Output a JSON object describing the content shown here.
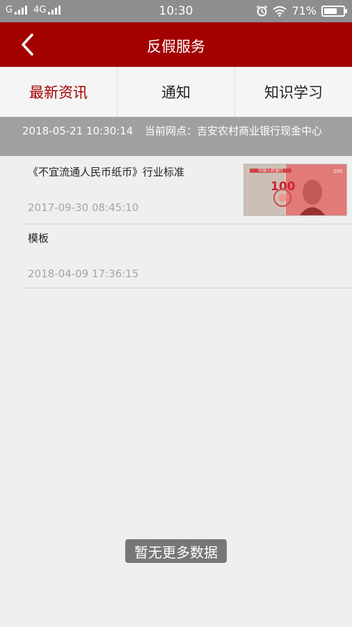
{
  "status_bar": {
    "carrier1": "G",
    "carrier2": "4G",
    "time": "10:30",
    "battery": "71%",
    "battery_level": 0.71
  },
  "header": {
    "title": "反假服务",
    "back_icon": "chevron-left-icon"
  },
  "tabs": [
    {
      "label": "最新资讯",
      "active": true
    },
    {
      "label": "通知",
      "active": false
    },
    {
      "label": "知识学习",
      "active": false
    }
  ],
  "info_bar": {
    "timestamp": "2018-05-21 10:30:14",
    "location_label": "当前网点：",
    "location_value": "吉安农村商业银行现金中心"
  },
  "news": [
    {
      "title": "《不宜流通人民币纸币》行业标准",
      "date": "2017-09-30 08:45:10",
      "has_thumbnail": true
    },
    {
      "title": "模板",
      "date": "2018-04-09 17:36:15",
      "has_thumbnail": false
    }
  ],
  "thumbnail": {
    "denomination": "100",
    "bank_text": "中国人民银行"
  },
  "toast": "暂无更多数据",
  "colors": {
    "brand_red": "#a30000",
    "status_bar": "#8e8e8e",
    "info_bar": "#a0a0a0",
    "background": "#efefef"
  }
}
